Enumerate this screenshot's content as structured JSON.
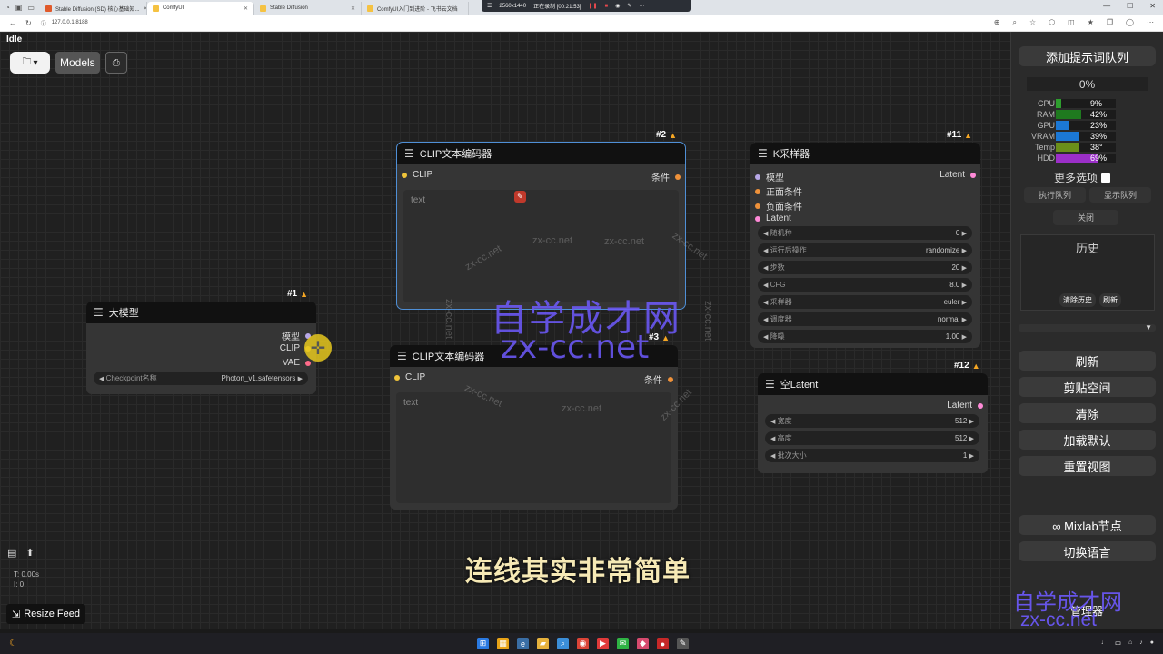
{
  "browser": {
    "tabs": [
      {
        "label": "Stable Diffusion (SD) 核心基础知...",
        "color": "#e05a2b"
      },
      {
        "label": "ComfyUI",
        "color": "#f5c242",
        "active": true
      },
      {
        "label": "Stable Diffusion",
        "color": "#f5c242"
      },
      {
        "label": "ComfyUI入门到进阶 - 飞书云文档",
        "color": "#f5c242"
      }
    ],
    "recording": {
      "resolution": "2560x1440",
      "status": "正在录制 [00:21:53]"
    },
    "url": "127.0.0.1:8188"
  },
  "canvas": {
    "status": "Idle",
    "models_label": "Models",
    "subtitle": "连线其实非常简单",
    "stats": {
      "time": "T: 0.00s",
      "i": "I: 0"
    },
    "resize_feed": "Resize Feed"
  },
  "watermark": {
    "cn": "自学成才网",
    "url": "zx-cc.net"
  },
  "nodes": {
    "checkpoint": {
      "id": "#1",
      "title": "大模型",
      "outputs": [
        "模型",
        "CLIP",
        "VAE"
      ],
      "widget_label": "Checkpoint名称",
      "widget_value": "Photon_v1.safetensors"
    },
    "clip_pos": {
      "id": "#2",
      "title": "CLIP文本编码器",
      "input": "CLIP",
      "output": "条件",
      "placeholder": "text"
    },
    "clip_neg": {
      "id": "#3",
      "title": "CLIP文本编码器",
      "input": "CLIP",
      "output": "条件",
      "placeholder": "text"
    },
    "ksampler": {
      "id": "#11",
      "title": "K采样器",
      "inputs": [
        "模型",
        "正面条件",
        "负面条件",
        "Latent"
      ],
      "output": "Latent",
      "widgets": [
        {
          "label": "随机种",
          "value": "0"
        },
        {
          "label": "运行后操作",
          "value": "randomize"
        },
        {
          "label": "步数",
          "value": "20"
        },
        {
          "label": "CFG",
          "value": "8.0"
        },
        {
          "label": "采样器",
          "value": "euler"
        },
        {
          "label": "调度器",
          "value": "normal"
        },
        {
          "label": "降噪",
          "value": "1.00"
        }
      ]
    },
    "latent": {
      "id": "#12",
      "title": "空Latent",
      "output": "Latent",
      "widgets": [
        {
          "label": "宽度",
          "value": "512"
        },
        {
          "label": "高度",
          "value": "512"
        },
        {
          "label": "批次大小",
          "value": "1"
        }
      ]
    }
  },
  "panel": {
    "queue_button": "添加提示词队列",
    "progress": "0%",
    "monitors": [
      {
        "label": "CPU",
        "value": "9%",
        "fraction": 0.09,
        "color": "#2e9e2e"
      },
      {
        "label": "RAM",
        "value": "42%",
        "fraction": 0.42,
        "color": "#1f7a1f"
      },
      {
        "label": "GPU",
        "value": "23%",
        "fraction": 0.23,
        "color": "#1b78d6"
      },
      {
        "label": "VRAM",
        "value": "39%",
        "fraction": 0.39,
        "color": "#1b78d6"
      },
      {
        "label": "Temp",
        "value": "38°",
        "fraction": 0.38,
        "color": "#6b8f1a"
      },
      {
        "label": "HDD",
        "value": "69%",
        "fraction": 0.69,
        "color": "#9b2fc8"
      }
    ],
    "more_options": "更多选项",
    "exec_queue": "执行队列",
    "show_queue": "显示队列",
    "close": "关闭",
    "history_title": "历史",
    "clear_history": "清除历史",
    "refresh_small": "刷新",
    "refresh": "刷新",
    "paste_space": "剪贴空间",
    "clear": "清除",
    "load_default": "加载默认",
    "reset_view": "重置视图",
    "mixlab": "∞ Mixlab节点",
    "switch_lang": "切换语言",
    "manager": "管理器"
  }
}
